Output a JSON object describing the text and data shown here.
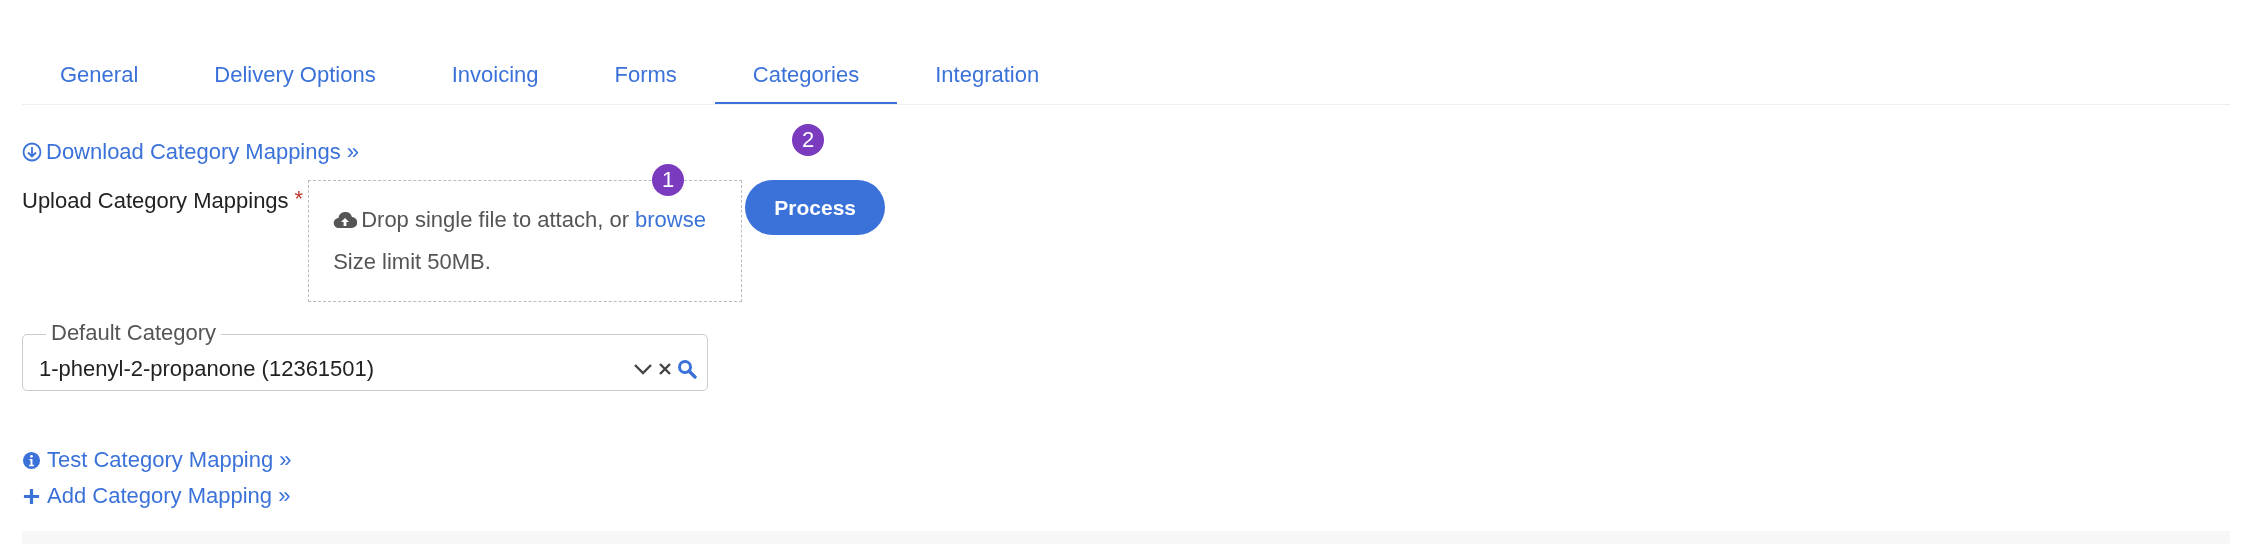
{
  "tabs": [
    {
      "label": "General",
      "selected": false
    },
    {
      "label": "Delivery Options",
      "selected": false
    },
    {
      "label": "Invoicing",
      "selected": false
    },
    {
      "label": "Forms",
      "selected": false
    },
    {
      "label": "Categories",
      "selected": true
    },
    {
      "label": "Integration",
      "selected": false
    }
  ],
  "download_link": "Download Category Mappings »",
  "upload": {
    "label": "Upload Category Mappings",
    "required_mark": "*",
    "drop_text": "Drop single file to attach, or",
    "browse_link": "browse",
    "size_limit": "Size limit 50MB.",
    "step_badge": "1"
  },
  "process_button": {
    "label": "Process",
    "step_badge": "2"
  },
  "default_category": {
    "label": "Default Category",
    "value": "1-phenyl-2-propanone (12361501)"
  },
  "links": [
    {
      "kind": "info",
      "label": "Test Category Mapping »"
    },
    {
      "kind": "add",
      "label": "Add Category Mapping »"
    }
  ]
}
